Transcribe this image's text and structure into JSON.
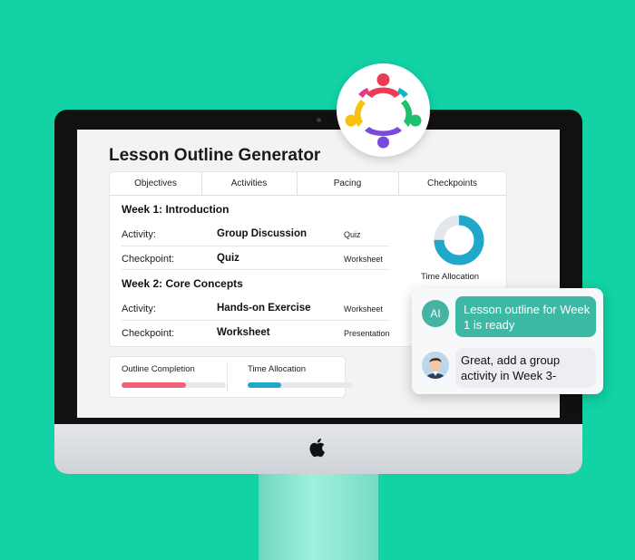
{
  "app": {
    "title": "Lesson Outline Generator"
  },
  "tabs": [
    {
      "label": "Objectives"
    },
    {
      "label": "Activities"
    },
    {
      "label": "Pacing"
    },
    {
      "label": "Checkpoints"
    }
  ],
  "weeks": [
    {
      "heading": "Week 1:  Introduction",
      "rows": [
        {
          "label": "Activity:",
          "value": "Group Discussion",
          "tag": "Quiz"
        },
        {
          "label": "Checkpoint:",
          "value": "Quiz",
          "tag": "Worksheet"
        }
      ]
    },
    {
      "heading": "Week 2:  Core Concepts",
      "rows": [
        {
          "label": "Activity:",
          "value": "Hands-on Exercise",
          "tag": "Worksheet"
        },
        {
          "label": "Checkpoint:",
          "value": "Worksheet",
          "tag": "Presentation"
        }
      ]
    }
  ],
  "time_allocation_chart": {
    "label": "Time Allocation",
    "fraction": 0.75,
    "color": "#1fa8c9",
    "track_color": "#e3e6ea"
  },
  "progress": [
    {
      "label": "Outline Completion",
      "fraction": 0.62,
      "color": "#f06279"
    },
    {
      "label": "Time Allocation",
      "fraction": 0.32,
      "color": "#1fa8c9"
    }
  ],
  "chat": {
    "ai_avatar": "AI",
    "ai_message": "Lesson outline for Week 1 is ready",
    "user_message": "Great, add a group activity in Week 3-",
    "ai_bubble_color": "#3cb8a4"
  },
  "icons": {
    "logo": "community-circle-logo",
    "device": "apple-logo",
    "user": "user-avatar"
  },
  "colors": {
    "background": "#12d2a6",
    "accent_teal": "#3cb8a4",
    "accent_pink": "#f06279"
  }
}
